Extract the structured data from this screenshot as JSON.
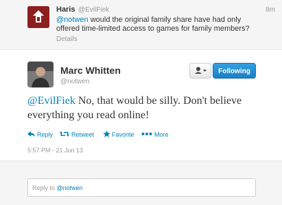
{
  "previous_tweet": {
    "name": "Haris",
    "handle": "@EvilFiek",
    "time": "8m",
    "mention": "@notwen",
    "text": " would the original family share have had only offered time-limited access to games for family members?",
    "details": "Details",
    "avatar_icon": "shield-avatar-icon"
  },
  "main_tweet": {
    "name": "Marc Whitten",
    "handle": "@notwen",
    "follow_label": "Following",
    "user_menu_icon": "user-dropdown-icon",
    "mention": "@EvilFiek",
    "text": " No, that would be silly. Don't believe everything you read online!",
    "actions": {
      "reply": "Reply",
      "retweet": "Retweet",
      "favorite": "Favorite",
      "more": "More"
    },
    "timestamp": "5:57 PM - 21 Jun 13"
  },
  "reply": {
    "prefix": "Reply to ",
    "mention": "@notwen"
  },
  "colors": {
    "link": "#0084b4",
    "follow_button": "#2b8fd6",
    "muted": "#999999"
  }
}
